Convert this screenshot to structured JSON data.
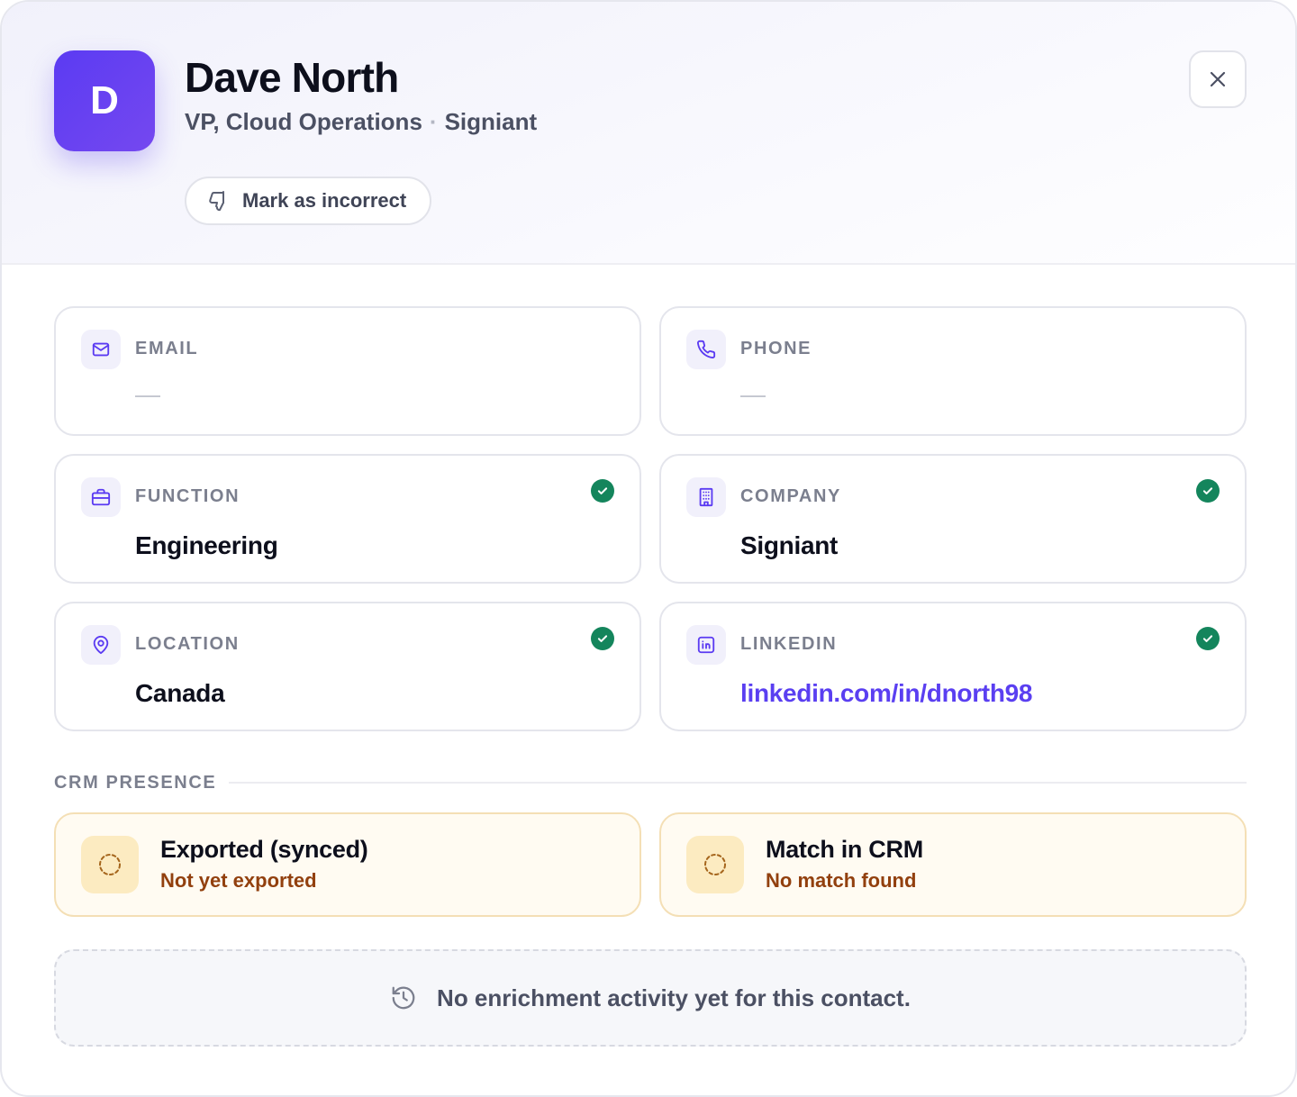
{
  "contact": {
    "initial": "D",
    "name": "Dave North",
    "title": "VP, Cloud Operations",
    "separator": "·",
    "company": "Signiant"
  },
  "actions": {
    "mark_incorrect_label": "Mark as incorrect",
    "mark_incorrect_icon": "thumbs-down-icon",
    "close_icon": "close-icon"
  },
  "fields": {
    "email": {
      "label": "EMAIL",
      "value": "—",
      "icon": "mail-icon",
      "verified": false
    },
    "phone": {
      "label": "PHONE",
      "value": "—",
      "icon": "phone-icon",
      "verified": false
    },
    "function": {
      "label": "FUNCTION",
      "value": "Engineering",
      "icon": "briefcase-icon",
      "verified": true
    },
    "company": {
      "label": "COMPANY",
      "value": "Signiant",
      "icon": "building-icon",
      "verified": true
    },
    "location": {
      "label": "LOCATION",
      "value": "Canada",
      "icon": "map-pin-icon",
      "verified": true
    },
    "linkedin": {
      "label": "LINKEDIN",
      "value": "linkedin.com/in/dnorth98",
      "icon": "linkedin-icon",
      "verified": true
    }
  },
  "crm": {
    "section_title": "CRM PRESENCE",
    "exported": {
      "title": "Exported (synced)",
      "status": "Not yet exported",
      "icon": "pending-circle-icon"
    },
    "match": {
      "title": "Match in CRM",
      "status": "No match found",
      "icon": "pending-circle-icon"
    }
  },
  "activity": {
    "message": "No enrichment activity yet for this contact.",
    "icon": "history-icon"
  },
  "colors": {
    "accent": "#5b3bf2",
    "link": "#5a3ff1",
    "verified": "#14855c",
    "crm_status": "#92400e",
    "crm_bg": "#fffbf2"
  }
}
